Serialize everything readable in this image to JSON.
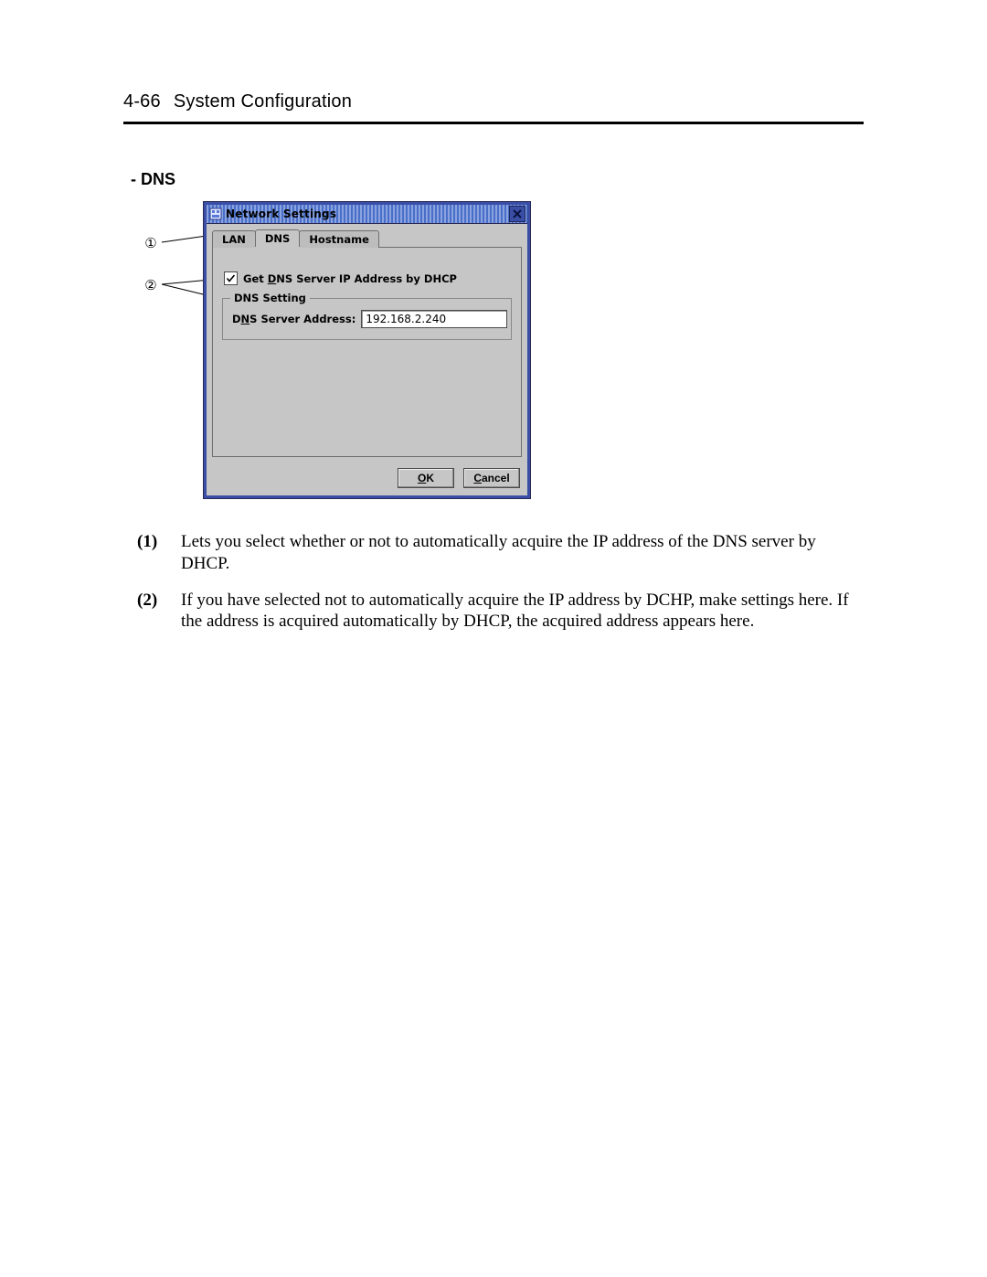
{
  "header": {
    "page_number": "4-66",
    "page_title": "System Configuration"
  },
  "section_heading": "- DNS",
  "callouts": {
    "c1": "①",
    "c2": "②"
  },
  "dialog": {
    "title": "Network Settings",
    "tabs": {
      "lan": "LAN",
      "dns": "DNS",
      "hostname": "Hostname"
    },
    "checkbox": {
      "pre": "Get ",
      "mn": "D",
      "post": "NS Server IP Address by DHCP"
    },
    "group_legend": "DNS Setting",
    "field": {
      "label_pre": "D",
      "label_mn": "N",
      "label_post": "S Server Address:",
      "value": "192.168.2.240"
    },
    "buttons": {
      "ok_mn": "O",
      "ok_post": "K",
      "cancel_mn": "C",
      "cancel_post": "ancel"
    }
  },
  "notes": {
    "n1_marker": "(1)",
    "n1_body": "Lets you select whether or not to automatically acquire the IP address of the DNS server by DHCP.",
    "n2_marker": "(2)",
    "n2_body": "If you have selected not to automatically acquire the IP address by DCHP, make settings here. If the address is acquired automatically by DHCP, the acquired address appears here."
  }
}
